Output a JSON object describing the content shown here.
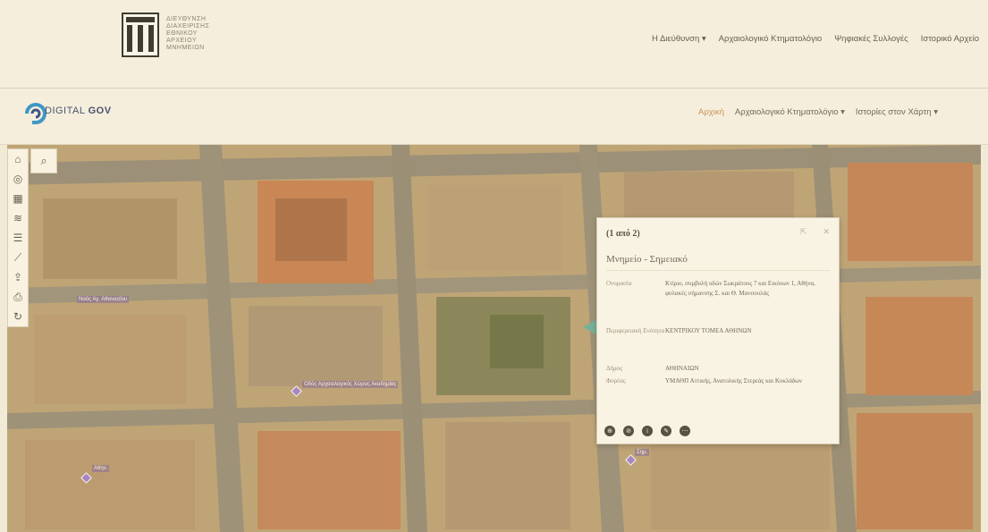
{
  "org": {
    "lines": [
      "ΔΙΕΥΘΥΝΣΗ",
      "ΔΙΑΧΕΙΡΙΣΗΣ",
      "ΕΘΝΙΚΟΥ",
      "ΑΡΧΕΙΟΥ",
      "ΜΝΗΜΕΙΩΝ"
    ]
  },
  "top_nav": [
    "Η Διεύθυνση ▾",
    "Αρχαιολογικό Κτηματολόγιο",
    "Ψηφιακές Συλλογές",
    "Ιστορικό Αρχείο"
  ],
  "digital_gov": {
    "word1": "DIGITAL",
    "word2": "GOV"
  },
  "sub_nav": {
    "home": "Αρχική",
    "cadastre": "Αρχαιολογικό Κτηματολόγιο ▾",
    "stories": "Ιστορίες στον Χάρτη ▾"
  },
  "map": {
    "labels": [
      "Ναός Αγ. Αθανασίου",
      "Οδός Αρχαιολογικός Χώρος Ακαδημίας",
      "Αθην.",
      "Σημ."
    ]
  },
  "popup": {
    "count": "(1 από 2)",
    "title": "Μνημείο - Σημειακό",
    "rows": [
      {
        "key": "Ονομασία",
        "val": "Κτίριο, συμβολή οδών Σωκράτους 7 και Εικόνων 1, Αθήνα, φυλακές σήμανσης Σ. και Θ. Μανσουλάς"
      },
      {
        "key": "Περιφερειακή Ενότητα",
        "val": "ΚΕΝΤΡΙΚΟΥ ΤΟΜΕΑ ΑΘΗΝΩΝ"
      },
      {
        "key": "Δήμος",
        "val": "ΑΘΗΝΑΙΩΝ"
      },
      {
        "key": "Φορέας",
        "val": "ΥΜΑΘΠ Αττικής, Ανατολικής Στερεάς και Κυκλάδων"
      }
    ]
  }
}
